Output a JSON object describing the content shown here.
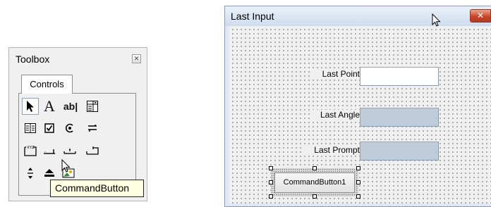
{
  "toolbox": {
    "title": "Toolbox",
    "close_glyph": "✕",
    "tab_label": "Controls",
    "tools": [
      {
        "name": "select-objects-tool",
        "icon": "pointer-icon"
      },
      {
        "name": "label-tool",
        "icon": "label-A-icon",
        "glyph": "A"
      },
      {
        "name": "textbox-tool",
        "icon": "textbox-icon",
        "glyph": "ab|"
      },
      {
        "name": "combobox-tool",
        "icon": "combobox-icon"
      },
      {
        "name": "listbox-tool",
        "icon": "listbox-icon"
      },
      {
        "name": "checkbox-tool",
        "icon": "checkbox-icon"
      },
      {
        "name": "optionbutton-tool",
        "icon": "option-button-icon"
      },
      {
        "name": "togglebutton-tool",
        "icon": "toggle-button-icon"
      },
      {
        "name": "frame-tool",
        "icon": "frame-icon"
      },
      {
        "name": "commandbutton-tool",
        "icon": "command-button-icon"
      },
      {
        "name": "tabstrip-tool",
        "icon": "tabstrip-icon"
      },
      {
        "name": "multipage-tool",
        "icon": "multipage-icon"
      },
      {
        "name": "scrollbar-tool",
        "icon": "scrollbar-icon"
      },
      {
        "name": "spinbutton-tool",
        "icon": "spinbutton-icon"
      },
      {
        "name": "image-tool",
        "icon": "image-icon"
      }
    ],
    "tooltip": "CommandButton"
  },
  "form": {
    "title": "Last Input",
    "close_glyph": "✕",
    "fields": [
      {
        "label": "Last Point",
        "value": "",
        "state": "enabled"
      },
      {
        "label": "Last Angle",
        "value": "",
        "state": "disabled"
      },
      {
        "label": "Last Prompt",
        "value": "",
        "state": "disabled"
      }
    ],
    "command_button_label": "CommandButton1"
  },
  "colors": {
    "titlebar": "#dfe8f4",
    "close_button": "#c8472b",
    "disabled_textbox": "#bfcddb",
    "tooltip_bg": "#ffffe1"
  }
}
